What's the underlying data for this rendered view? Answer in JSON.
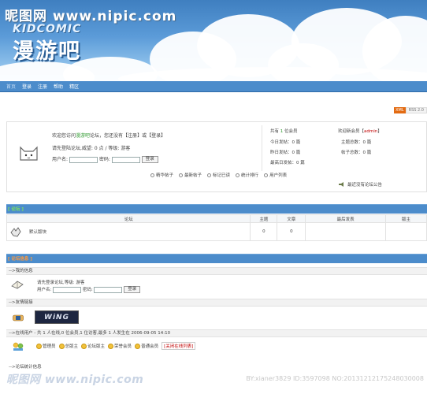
{
  "watermark": {
    "top": "昵图网 www.nipic.com",
    "bottom_left": "昵图网 www.nipic.com",
    "bottom_user": "BY:xianer3829",
    "bottom_id": "ID:3597098 NO:20131212175248030008"
  },
  "banner": {
    "logo_en": "KIDCOMIC",
    "logo_cn": "漫游吧"
  },
  "nav": {
    "items": [
      "首页",
      "登录",
      "注册",
      "帮助",
      "精区"
    ]
  },
  "rss": {
    "xml": "XML",
    "rss": "RSS 2.0"
  },
  "welcome": {
    "line1_pre": "欢迎您访问",
    "site_name": "漫游吧",
    "line1_post": "论坛，您还没有【",
    "register": "注册",
    "or": "】或【",
    "login": "登录",
    "close": "】",
    "line2": "请先登陆论坛,威望: 0 点 / 等级: 游客",
    "username_label": "用户名:",
    "password_label": "密码:",
    "login_button": "登录"
  },
  "stats": {
    "members_pre": "共有",
    "members_count": "1",
    "members_post": "位会员",
    "newest_label": "欢迎新会员【",
    "newest_name": "admin",
    "newest_close": "】",
    "today": "今日发帖：0 篇",
    "topics": "主题总数：0 篇",
    "yesterday": "昨日发帖：0 篇",
    "posts": "帖子总数：0 篇",
    "max_day": "最高日发帖：0 篇"
  },
  "links": [
    "精华帖子",
    "最新帖子",
    "标记已读",
    "统计排行",
    "用户列表"
  ],
  "notice": "最近没有论坛公告",
  "section1": {
    "title": "[ 论坛 ]"
  },
  "forum_table": {
    "headers": [
      "论坛",
      "主题",
      "文章",
      "最后发表",
      "版主"
    ],
    "rows": [
      {
        "name": "默认版块",
        "topics": "0",
        "posts": "0",
        "last": "",
        "mod": ""
      }
    ]
  },
  "section2": {
    "title": "[ 论坛信息 ]",
    "my_info": "-->我的信息",
    "my_line": "请先登录论坛,等级: 游客",
    "username_label": "用户名:",
    "password_label": "密码:",
    "login_button": "登录",
    "links_head": "-->友情链接",
    "link_logo": "WiNG",
    "online_head": "-->在线用户 - 共 1 人在线,0 位会员,1 位访客,最多 1 人发生在 2006-09-05 14:10",
    "legend": [
      "管理员",
      "总版主",
      "论坛版主",
      "荣誉会员",
      "普通会员"
    ],
    "legend_link": "[关闭在线列表]",
    "stats_head": "-->论坛统计信息"
  }
}
